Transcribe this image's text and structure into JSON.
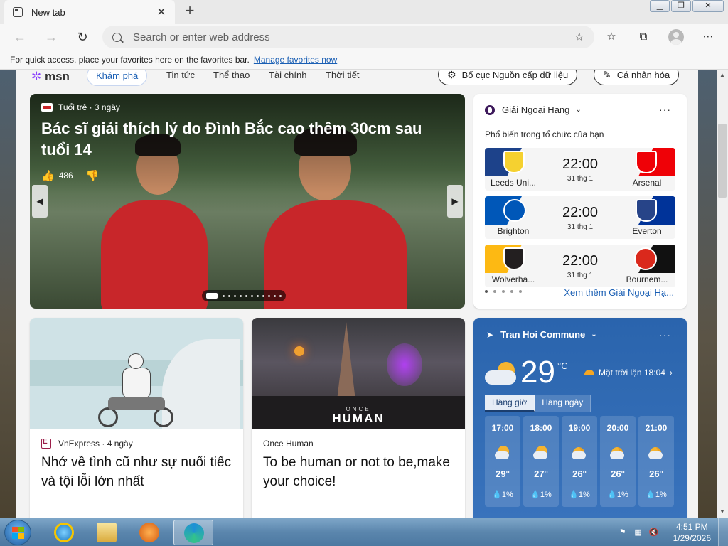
{
  "browser": {
    "tab_title": "New tab",
    "address_placeholder": "Search or enter web address",
    "favbar_text": "For quick access, place your favorites here on the favorites bar.",
    "favbar_link": "Manage favorites now"
  },
  "msn": {
    "logo": "msn",
    "nav_active": "Khám phá",
    "nav_links": [
      "Tin tức",
      "Thể thao",
      "Tài chính",
      "Thời tiết"
    ],
    "layout_button": "Bố cục Nguồn cấp dữ liệu",
    "personalize_button": "Cá nhân hóa"
  },
  "hero": {
    "source": "Tuổi trẻ · 3 ngày",
    "title": "Bác sĩ giải thích lý do Đình Bắc cao thêm 30cm sau tuổi 14",
    "likes": "486"
  },
  "sport": {
    "league": "Giải Ngoại Hạng",
    "subtitle": "Phổ biến trong tổ chức của bạn",
    "matches": [
      {
        "home": "Leeds Uni...",
        "away": "Arsenal",
        "time": "22:00",
        "date": "31 thg 1",
        "home_color": "#1d428a",
        "away_color": "#ef0107"
      },
      {
        "home": "Brighton",
        "away": "Everton",
        "time": "22:00",
        "date": "31 thg 1",
        "home_color": "#0057b8",
        "away_color": "#003399"
      },
      {
        "home": "Wolverha...",
        "away": "Bournem...",
        "time": "22:00",
        "date": "31 thg 1",
        "home_color": "#fdb913",
        "away_color": "#111111"
      }
    ],
    "more_link": "Xem thêm Giải Ngoại Hạ..."
  },
  "articles": [
    {
      "source": "VnExpress · 4 ngày",
      "title": "Nhớ về tình cũ như sự nuối tiếc và tội lỗi lớn nhất"
    },
    {
      "source": "Once Human",
      "title": "To be human or not to be,make your choice!",
      "image_text": "HUMAN",
      "image_kicker": "ONCE"
    }
  ],
  "weather": {
    "location": "Tran Hoi Commune",
    "temp": "29",
    "unit": "°C",
    "sunset": "Mặt trời lặn 18:04",
    "tab_hourly": "Hàng giờ",
    "tab_daily": "Hàng ngày",
    "hours": [
      {
        "time": "17:00",
        "temp": "29°",
        "rain": "1%",
        "icon": "partly-sunny-icon"
      },
      {
        "time": "18:00",
        "temp": "27°",
        "rain": "1%",
        "icon": "partly-sunny-icon"
      },
      {
        "time": "19:00",
        "temp": "26°",
        "rain": "1%",
        "icon": "partly-cloudy-night-icon"
      },
      {
        "time": "20:00",
        "temp": "26°",
        "rain": "1%",
        "icon": "partly-cloudy-night-icon"
      },
      {
        "time": "21:00",
        "temp": "26°",
        "rain": "1%",
        "icon": "partly-cloudy-night-icon"
      }
    ]
  },
  "taskbar": {
    "time": "4:51 PM",
    "date": "1/29/2026"
  }
}
